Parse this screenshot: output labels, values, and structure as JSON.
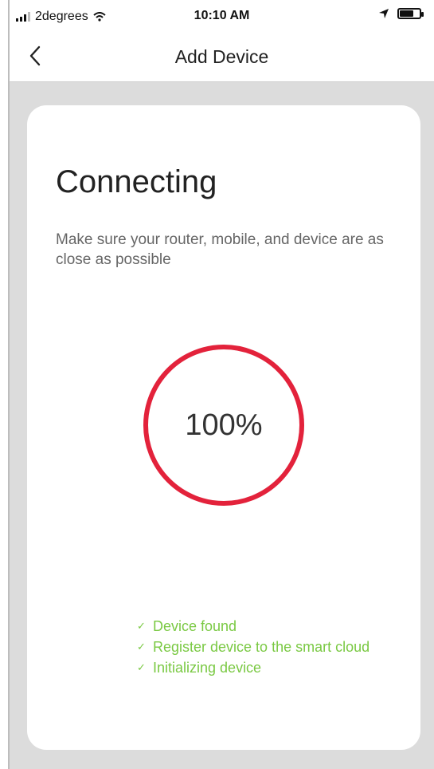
{
  "status_bar": {
    "carrier": "2degrees",
    "time": "10:10 AM",
    "battery_level": 0.7,
    "icons": [
      "signal-icon",
      "wifi-icon",
      "location-icon",
      "battery-icon"
    ]
  },
  "nav": {
    "title": "Add Device",
    "back_icon": "chevron-left-icon"
  },
  "card": {
    "heading": "Connecting",
    "description": "Make sure your router, mobile, and device are as close as possible",
    "progress": {
      "label": "100%",
      "value": 1.0,
      "color": "#e3223b"
    },
    "steps": [
      {
        "label": "Device found",
        "icon": "check-icon"
      },
      {
        "label": "Register device to the smart cloud",
        "icon": "check-icon"
      },
      {
        "label": "Initializing device",
        "icon": "check-icon"
      }
    ]
  },
  "colors": {
    "background": "#dcdcdc",
    "success": "#7ac943",
    "accent": "#e3223b"
  }
}
